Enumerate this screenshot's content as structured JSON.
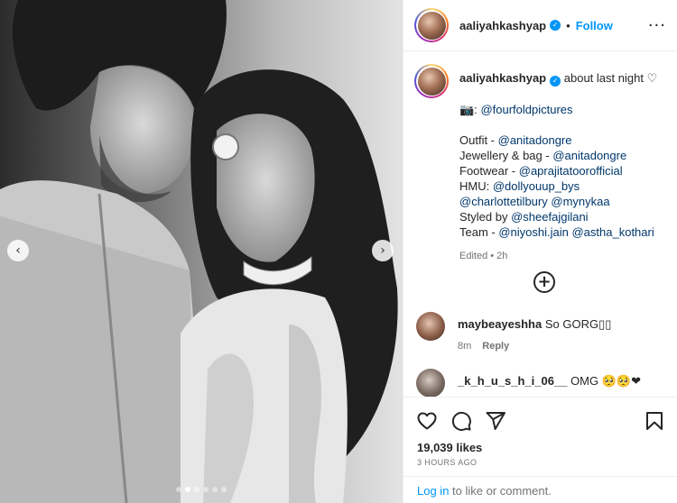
{
  "post": {
    "username": "aaliyahkashyap",
    "follow_label": "Follow",
    "bullet": "•",
    "more_icon": "more-options-icon",
    "caption": {
      "text_lead": "about last night",
      "heart_icon": "heart-outline-icon",
      "camera_glyph": "📷:",
      "photo_credit": "@fourfoldpictures",
      "outfit_label": "Outfit - ",
      "outfit_mention": "@anitadongre",
      "jewellery_label": "Jewellery & bag - ",
      "jewellery_mention": "@anitadongre",
      "footwear_label": "Footwear - ",
      "footwear_mention": "@aprajitatoorofficial",
      "hmu_label": "HMU: ",
      "hmu_mention": "@dollyouup_bys",
      "hmu_mention2": "@charlottetilbury",
      "hmu_mention3": "@mynykaa",
      "styled_label": "Styled by ",
      "styled_mention": "@sheefajgilani",
      "team_label": "Team - ",
      "team_mention1": "@niyoshi.jain",
      "team_mention2": "@astha_kothari",
      "edited": "Edited • 2h"
    },
    "comments": [
      {
        "user": "maybeayeshha",
        "text": "So GORG▯▯",
        "time": "8m",
        "reply": "Reply"
      },
      {
        "user": "_k_h_u_s_h_i_06__",
        "text": "OMG 🥺🥺❤"
      }
    ],
    "likes": "19,039 likes",
    "time_ago": "3 HOURS AGO",
    "login_link": "Log in",
    "login_suffix": " to like or comment.",
    "carousel": {
      "slide_count": 6,
      "active_index": 1
    },
    "colors": {
      "accent": "#0095f6",
      "mention": "#00376b",
      "heart": "#ed4956"
    }
  }
}
